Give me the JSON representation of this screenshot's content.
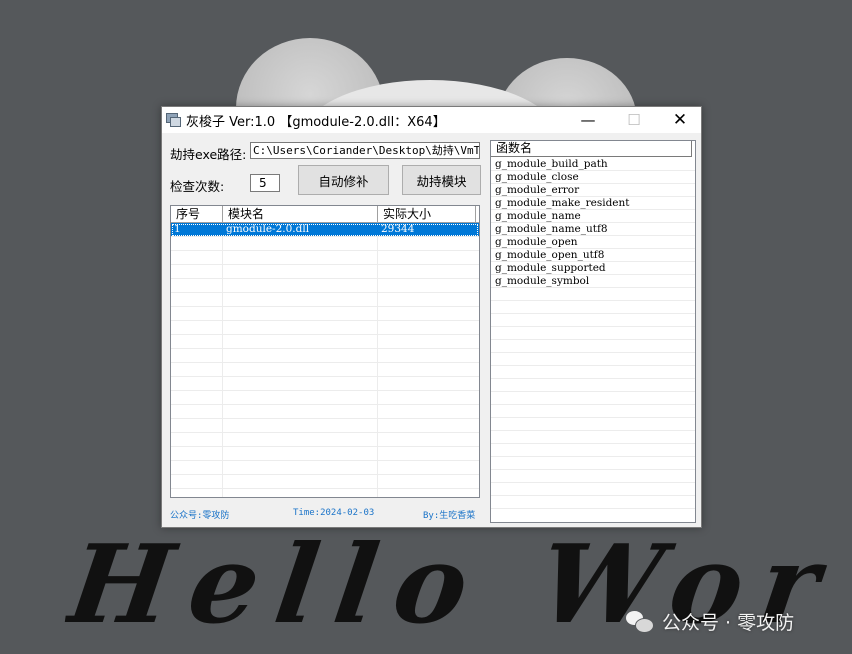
{
  "window": {
    "title": "灰梭子 Ver:1.0 【gmodule-2.0.dll：X64】",
    "minimize_glyph": "—",
    "maximize_glyph": "☐",
    "close_glyph": "✕"
  },
  "form": {
    "exe_path_label": "劫持exe路径:",
    "exe_path_value": "C:\\Users\\Coriander\\Desktop\\劫持\\VmTOol",
    "check_count_label": "检查次数:",
    "check_count_value": "5",
    "auto_patch_button": "自动修补",
    "hijack_module_button": "劫持模块"
  },
  "module_table": {
    "columns": [
      "序号",
      "模块名",
      "实际大小"
    ],
    "rows": [
      {
        "index": "1",
        "name": "gmodule-2.0.dll",
        "size": "29344",
        "selected": true
      }
    ]
  },
  "function_table": {
    "column": "函数名",
    "rows": [
      "g_module_build_path",
      "g_module_close",
      "g_module_error",
      "g_module_make_resident",
      "g_module_name",
      "g_module_name_utf8",
      "g_module_open",
      "g_module_open_utf8",
      "g_module_supported",
      "g_module_symbol"
    ]
  },
  "status_bar": {
    "account": "公众号:零攻防",
    "time": "Time:2024-02-03",
    "author": "By:生吃香菜"
  },
  "wallpaper": {
    "text": "Hello World",
    "watermark": "公众号 · 零攻防"
  },
  "colors": {
    "selection": "#0078d7",
    "status_text": "#1a73c8",
    "desktop": "#55585b"
  }
}
